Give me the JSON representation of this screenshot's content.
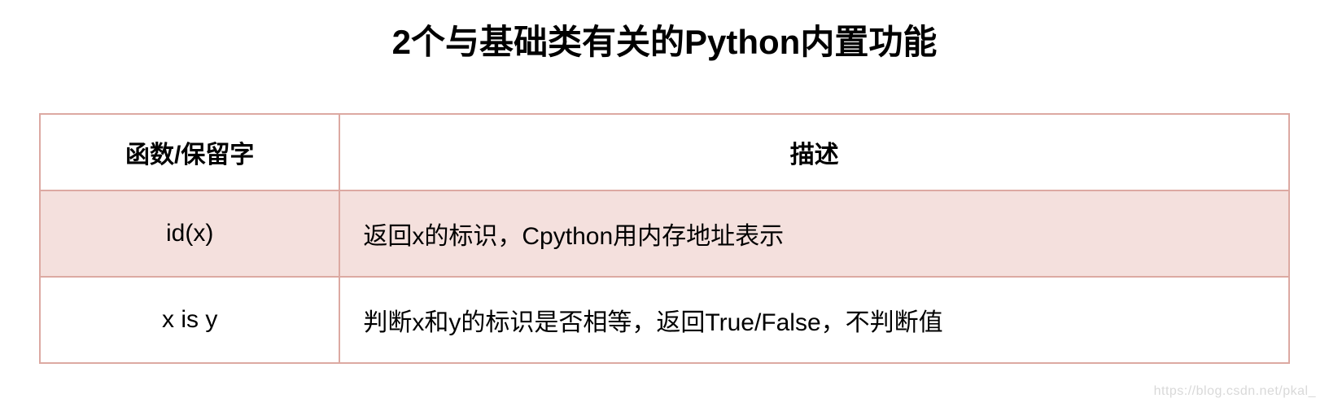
{
  "title": "2个与基础类有关的Python内置功能",
  "table": {
    "headers": {
      "func": "函数/保留字",
      "desc": "描述"
    },
    "rows": [
      {
        "func": "id(x)",
        "desc": "返回x的标识，Cpython用内存地址表示",
        "highlight": true
      },
      {
        "func": "x is y",
        "desc": "判断x和y的标识是否相等，返回True/False，不判断值",
        "highlight": false
      }
    ]
  },
  "watermark": "https://blog.csdn.net/pkal_"
}
